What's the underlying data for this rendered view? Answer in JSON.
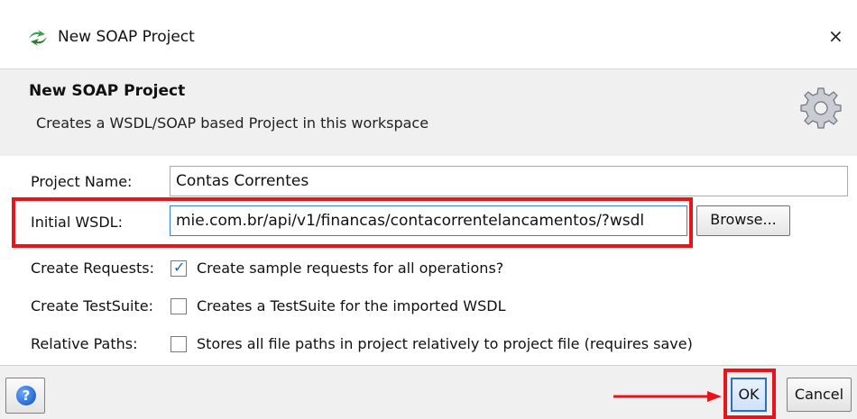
{
  "window": {
    "title": "New SOAP Project",
    "close_glyph": "×",
    "icon": "soapui-logo-icon"
  },
  "header": {
    "title": "New SOAP Project",
    "description": "Creates a WSDL/SOAP based Project in this workspace",
    "icon": "gear-icon"
  },
  "form": {
    "project_name_label": "Project Name:",
    "project_name_value": "Contas Correntes",
    "initial_wsdl_label": "Initial WSDL:",
    "initial_wsdl_value": "mie.com.br/api/v1/financas/contacorrentelancamentos/?wsdl",
    "browse_label": "Browse...",
    "create_requests_label": "Create Requests:",
    "create_requests_checked": true,
    "create_requests_text": "Create sample requests for all operations?",
    "create_testsuite_label": "Create TestSuite:",
    "create_testsuite_checked": false,
    "create_testsuite_text": "Creates a TestSuite for the imported WSDL",
    "relative_paths_label": "Relative Paths:",
    "relative_paths_checked": false,
    "relative_paths_text": "Stores all file paths in project relatively to project file (requires save)"
  },
  "footer": {
    "help_glyph": "?",
    "ok_label": "OK",
    "cancel_label": "Cancel"
  },
  "colors": {
    "highlight": "#e8141c",
    "header_bg": "#f0f0f0",
    "accent": "#1d5fbf"
  }
}
